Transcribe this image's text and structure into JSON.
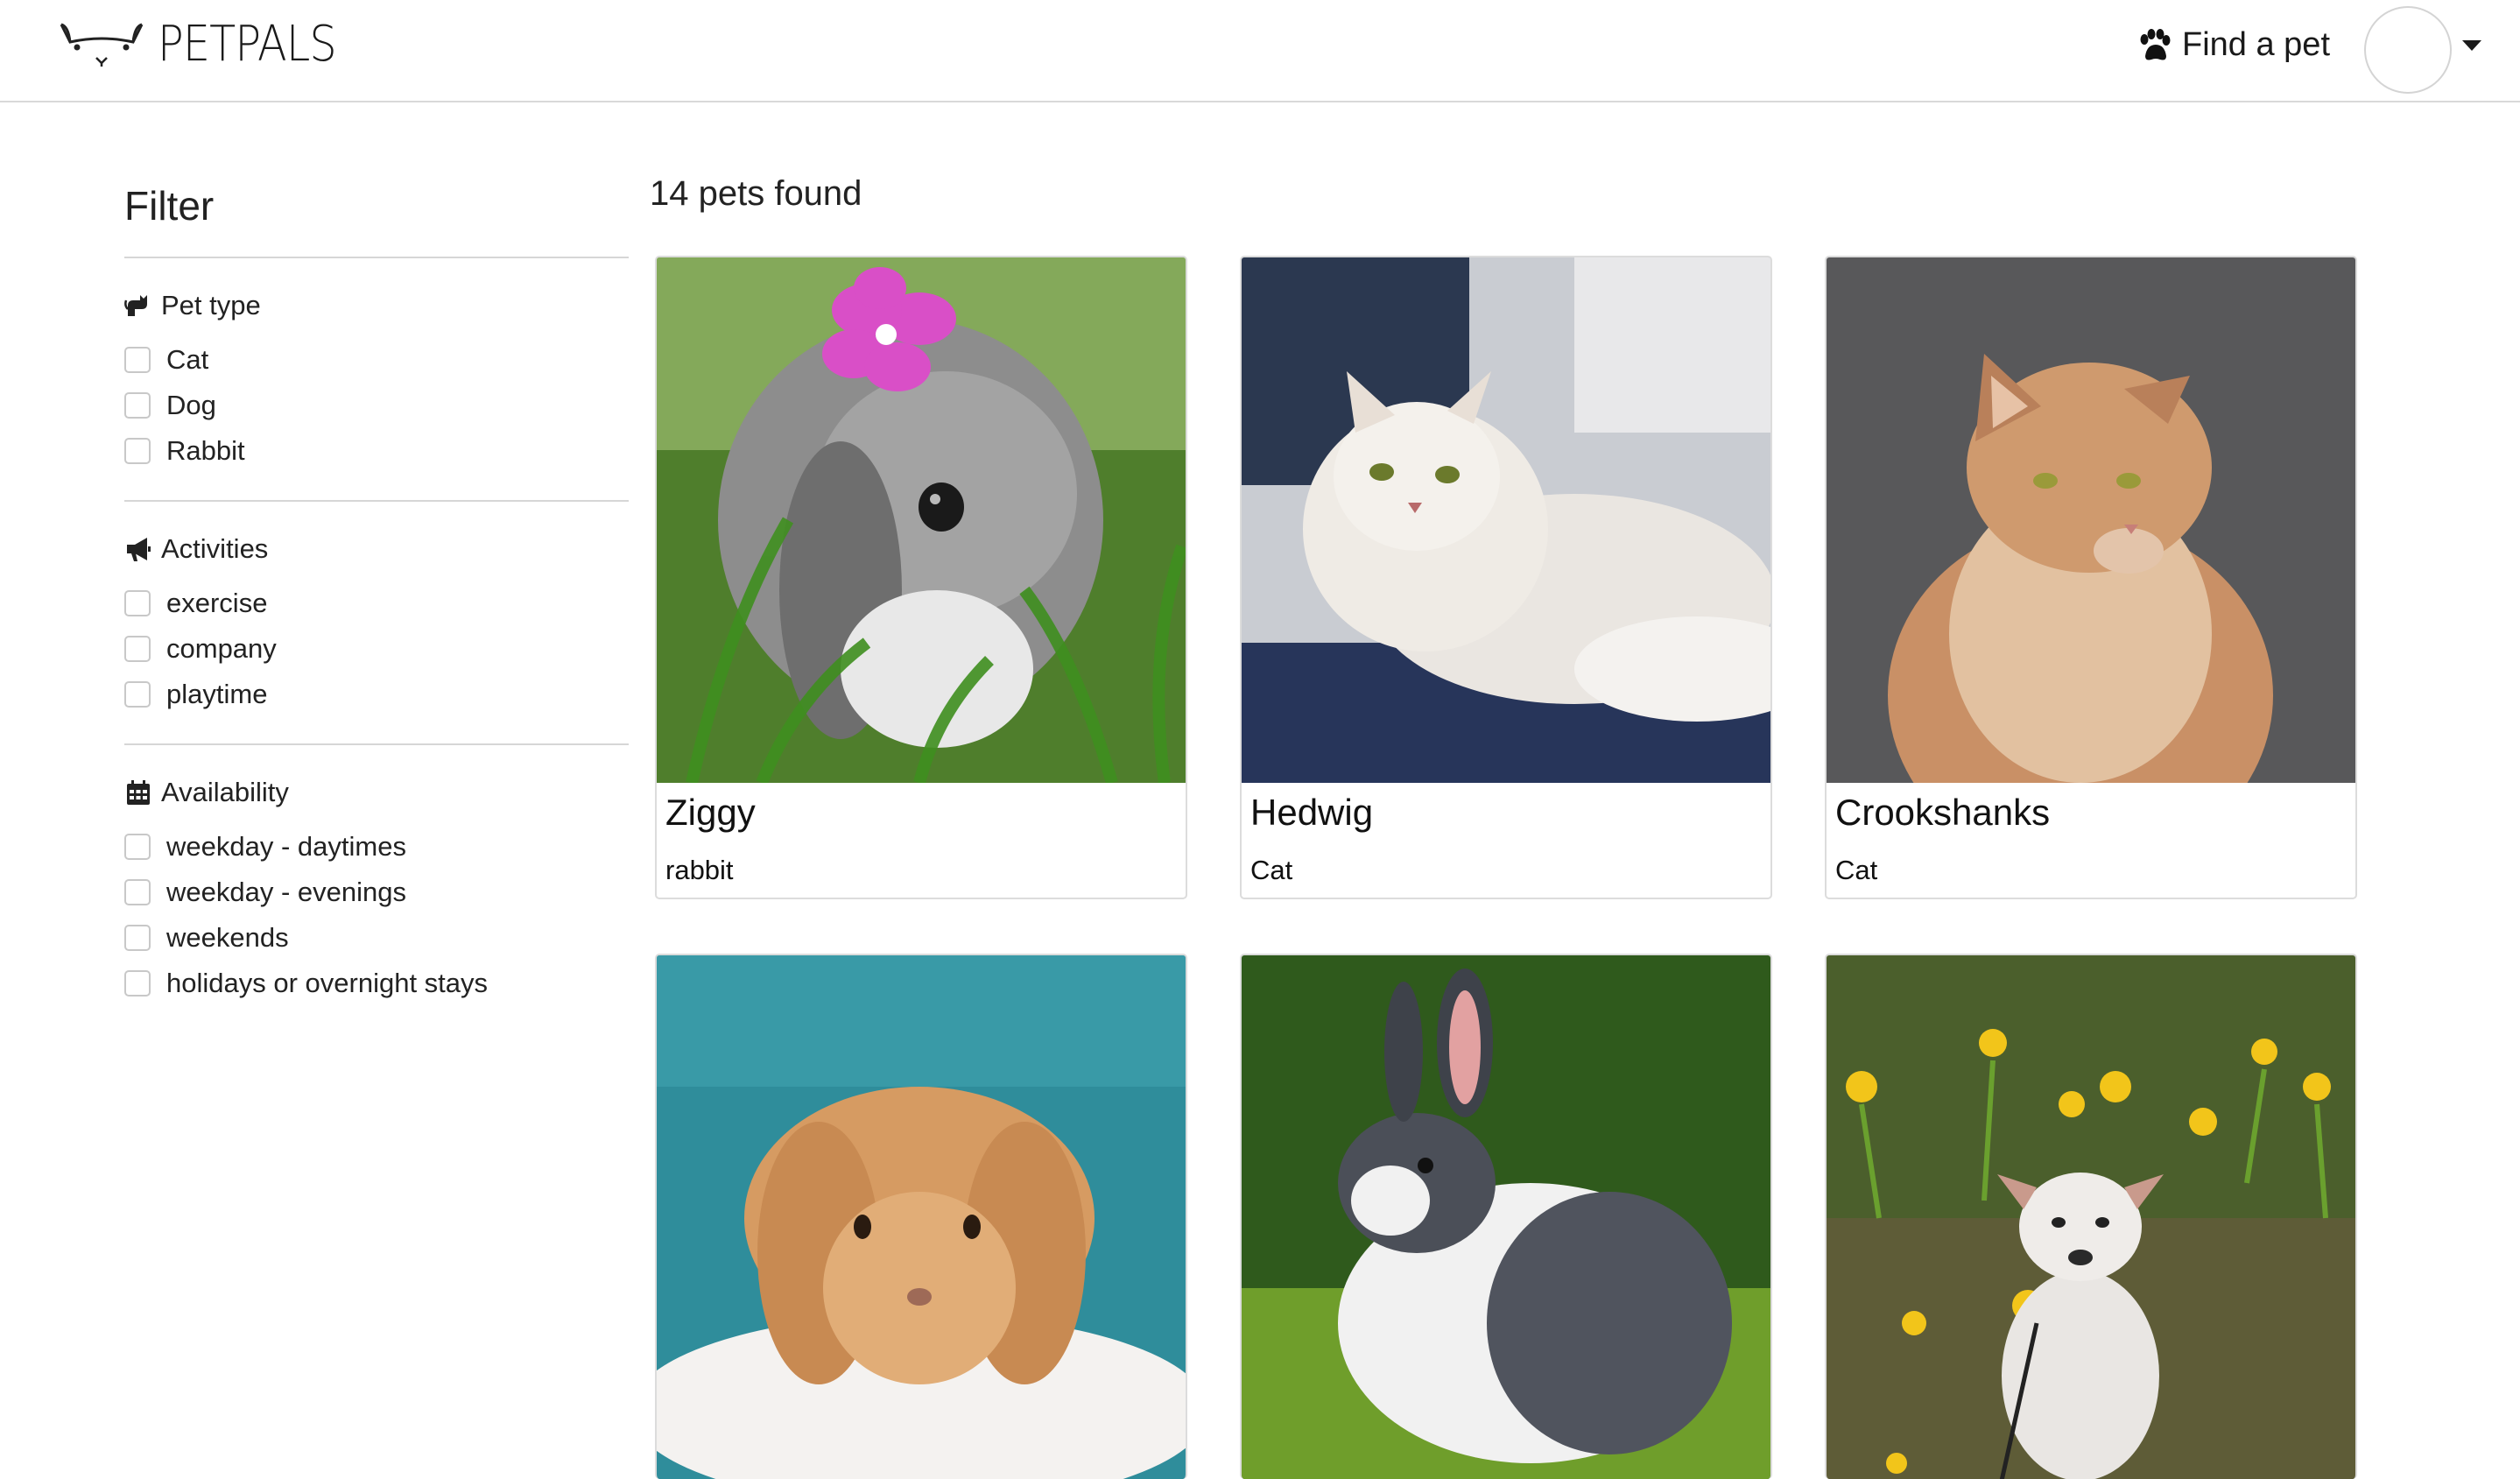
{
  "header": {
    "brand": "PETPALS",
    "find_pet": "Find a pet"
  },
  "sidebar": {
    "title": "Filter",
    "groups": [
      {
        "title": "Pet type",
        "icon": "cat-icon",
        "options": [
          "Cat",
          "Dog",
          "Rabbit"
        ]
      },
      {
        "title": "Activities",
        "icon": "megaphone-icon",
        "options": [
          "exercise",
          "company",
          "playtime"
        ]
      },
      {
        "title": "Availability",
        "icon": "calendar-icon",
        "options": [
          "weekday - daytimes",
          "weekday - evenings",
          "weekends",
          "holidays or overnight stays"
        ]
      }
    ]
  },
  "results": {
    "count_label": "14 pets found",
    "pets": [
      {
        "name": "Ziggy",
        "type": "rabbit",
        "photo": "grey lop rabbit with pink flower"
      },
      {
        "name": "Hedwig",
        "type": "Cat",
        "photo": "white persian cat"
      },
      {
        "name": "Crookshanks",
        "type": "Cat",
        "photo": "ginger maine coon cat"
      },
      {
        "name": "",
        "type": "",
        "photo": "orange lop rabbit on fur"
      },
      {
        "name": "",
        "type": "",
        "photo": "black and white rabbit in grass"
      },
      {
        "name": "",
        "type": "",
        "photo": "white dog among daffodils"
      }
    ]
  },
  "colors": {
    "border": "#dcdcdc",
    "text": "#222222"
  }
}
